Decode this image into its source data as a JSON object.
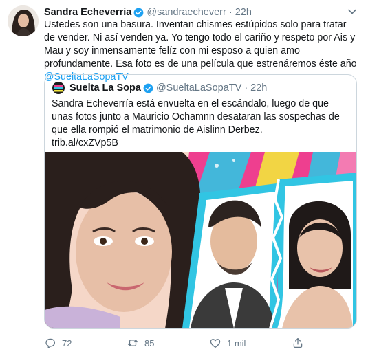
{
  "tweet": {
    "author_name": "Sandra Echeverria",
    "author_handle": "@sandraecheverr",
    "separator": "·",
    "timestamp": "22h",
    "text": "Ustedes son una basura. Inventan chismes estúpidos solo para tratar de vender. Ni así venden ya. Yo tengo todo el cariño y respeto por Ais y Mau y soy inmensamente felíz con mi esposo a quien amo profundamente. Esa foto es de una película que estrenáremos éste año ",
    "mention": "@SueltaLaSopaTV"
  },
  "quoted": {
    "author_name": "Suelta La Sopa",
    "author_handle": "@SueltaLaSopaTV",
    "separator": "·",
    "timestamp": "22h",
    "text": "Sandra Echeverría está envuelta en el escándalo, luego de que unas fotos junto a Mauricio Ochamnn desataran las sospechas de que ella rompió el matrimonio de Aislinn Derbez.",
    "link": "trib.al/cxZVp5B"
  },
  "actions": {
    "reply_count": "72",
    "retweet_count": "85",
    "like_count": "1 mil"
  },
  "colors": {
    "accent": "#1da1f2",
    "secondary_text": "#657786",
    "border": "#ccd6dd",
    "image_pink": "#ee3f8f",
    "image_cyan": "#31c5e3",
    "image_yellow": "#f3e63c"
  },
  "icons": [
    "verified-badge-icon",
    "chevron-down-icon",
    "reply-icon",
    "retweet-icon",
    "like-icon",
    "share-icon"
  ]
}
